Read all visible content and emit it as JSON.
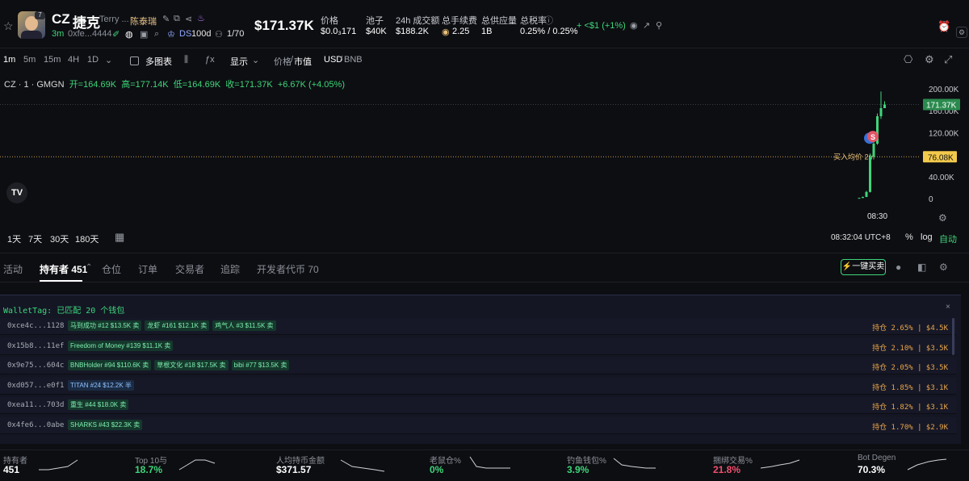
{
  "header": {
    "avatar_badge": "7",
    "symbol": "CZ",
    "name": "捷克",
    "creator_short": "Terry ...",
    "creator_alias": "陈泰瑞",
    "age": "3m",
    "address": "0xfe...4444",
    "ds_label": "DS",
    "age_days": "100d",
    "ratio": "1/70",
    "market_cap": "$171.37K",
    "stats": [
      {
        "label": "价格",
        "value": "$0.0₃171"
      },
      {
        "label": "池子",
        "value": "$40K"
      },
      {
        "label": "24h 成交额",
        "value": "$188.2K"
      },
      {
        "label": "总手续费",
        "value": "2.25"
      },
      {
        "label": "总供应量",
        "value": "1B"
      },
      {
        "label": "总税率",
        "value": "0.25% / 0.25%"
      }
    ],
    "change": "+ <$1 (+1%)"
  },
  "toolbar": {
    "intervals": [
      "1m",
      "5m",
      "15m",
      "4H",
      "1D"
    ],
    "multichart": "多图表",
    "display": "显示",
    "price_label": "价格",
    "mcap_label": "市值",
    "currency_active": "USD",
    "currency_other": "BNB",
    "price_sep": "/",
    "currency_sep": "/"
  },
  "chart_data": {
    "type": "candlestick",
    "title": "CZ · 1 · GMGN",
    "ohlc_text": {
      "open": "开=164.69K",
      "high": "高=177.14K",
      "low": "低=164.69K",
      "close": "收=171.37K",
      "change": "+6.67K (+4.05%)"
    },
    "y_ticks": [
      "200.00K",
      "160.00K",
      "120.00K",
      "40.00K",
      "0"
    ],
    "ylim": [
      0,
      200000
    ],
    "current_price_label": "171.37K",
    "avg_buy_label": "76.08K",
    "avg_buy_text": "买入均价 2m",
    "x_label": "08:30",
    "candles": [
      {
        "o": 500,
        "c": 1200,
        "h": 1500,
        "l": 400
      },
      {
        "o": 1200,
        "c": 3000,
        "h": 3500,
        "l": 1000
      },
      {
        "o": 3000,
        "c": 12000,
        "h": 14000,
        "l": 2500
      },
      {
        "o": 12000,
        "c": 76000,
        "h": 82000,
        "l": 11000
      },
      {
        "o": 76000,
        "c": 100000,
        "h": 108000,
        "l": 72000
      },
      {
        "o": 100000,
        "c": 150000,
        "h": 155000,
        "l": 98000
      },
      {
        "o": 150000,
        "c": 164690,
        "h": 195000,
        "l": 145000
      },
      {
        "o": 164690,
        "c": 171370,
        "h": 177140,
        "l": 164690
      }
    ],
    "marker_label": "S"
  },
  "chart_footer": {
    "ranges": [
      "1天",
      "7天",
      "30天",
      "180天"
    ],
    "time": "08:32:04 UTC+8",
    "pct": "%",
    "log": "log",
    "auto": "自动"
  },
  "tabs": [
    {
      "label": "活动"
    },
    {
      "label": "持有者 451"
    },
    {
      "label": "仓位"
    },
    {
      "label": "订单"
    },
    {
      "label": "交易者"
    },
    {
      "label": "追踪"
    },
    {
      "label": "开发者代币 70"
    }
  ],
  "buy_button": "一键买卖",
  "wallettag": {
    "title": "WalletTag: 已匹配 20 个钱包",
    "rows": [
      {
        "addr": "0xce4c...1128",
        "chips": [
          {
            "t": "马到成功 #12 $13.5K 卖",
            "c": "g"
          },
          {
            "t": "龙虾 #161 $12.1K 卖",
            "c": "g"
          },
          {
            "t": "鸡气人 #3 $11.5K 卖",
            "c": "g"
          }
        ],
        "hold": "持仓 2.65% | $4.5K"
      },
      {
        "addr": "0x15b8...11ef",
        "chips": [
          {
            "t": "Freedom of Money #139 $11.1K 卖",
            "c": "g"
          }
        ],
        "hold": "持仓 2.10% | $3.5K"
      },
      {
        "addr": "0x9e75...604c",
        "chips": [
          {
            "t": "BNBHolder #94 $110.6K 卖",
            "c": "g"
          },
          {
            "t": "草根文化 #18 $17.5K 卖",
            "c": "g"
          },
          {
            "t": "bibi #77 $13.5K 卖",
            "c": "g"
          }
        ],
        "hold": "持仓 2.05% | $3.5K"
      },
      {
        "addr": "0xd057...e0f1",
        "chips": [
          {
            "t": "TITAN #24 $12.2K 半",
            "c": "b"
          }
        ],
        "hold": "持仓 1.85% | $3.1K"
      },
      {
        "addr": "0xea11...703d",
        "chips": [
          {
            "t": "重生 #44 $18.0K 卖",
            "c": "g"
          }
        ],
        "hold": "持仓 1.82% | $3.1K"
      },
      {
        "addr": "0x4fe6...0abe",
        "chips": [
          {
            "t": "SHARKS #43 $22.3K 卖",
            "c": "g"
          }
        ],
        "hold": "持仓 1.70% | $2.9K"
      }
    ]
  },
  "footer": [
    {
      "label": "持有者",
      "value": "451",
      "color": "#ffffff"
    },
    {
      "label": "Top 10与",
      "value": "18.7%",
      "color": "#3ed67a"
    },
    {
      "label": "人均持币金额",
      "value": "$371.57",
      "color": "#ffffff"
    },
    {
      "label": "老鼠仓%",
      "value": "0%",
      "color": "#3ed67a"
    },
    {
      "label": "钓鱼钱包%",
      "value": "3.9%",
      "color": "#3ed67a"
    },
    {
      "label": "捆绑交易%",
      "value": "21.8%",
      "color": "#f0506e"
    },
    {
      "label": "Bot Degen",
      "value": "70.3%",
      "color": "#ffffff"
    }
  ]
}
